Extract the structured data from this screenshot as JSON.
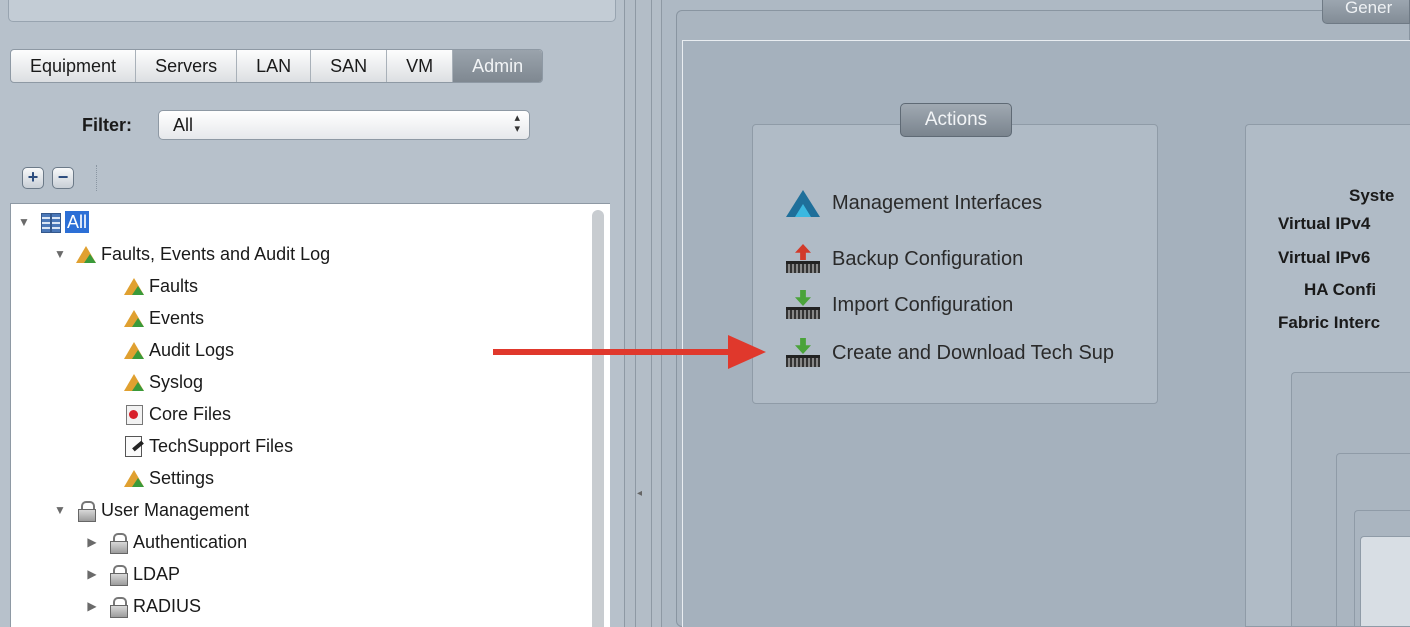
{
  "nav": {
    "tabs": [
      {
        "label": "Equipment"
      },
      {
        "label": "Servers"
      },
      {
        "label": "LAN"
      },
      {
        "label": "SAN"
      },
      {
        "label": "VM"
      },
      {
        "label": "Admin"
      }
    ],
    "active_tab": "Admin",
    "filter": {
      "label": "Filter:",
      "value": "All"
    },
    "tree": {
      "root": "All",
      "faults_group": "Faults, Events and Audit Log",
      "faults_children": [
        "Faults",
        "Events",
        "Audit Logs",
        "Syslog",
        "Core Files",
        "TechSupport Files",
        "Settings"
      ],
      "user_mgmt": "User Management",
      "user_mgmt_children": [
        "Authentication",
        "LDAP",
        "RADIUS"
      ]
    }
  },
  "content": {
    "general_tab": "Gener",
    "actions": {
      "title": "Actions",
      "items": [
        {
          "label": "Management Interfaces",
          "icon": "management-interfaces-icon"
        },
        {
          "label": "Backup Configuration",
          "icon": "backup-icon"
        },
        {
          "label": "Import Configuration",
          "icon": "import-icon"
        },
        {
          "label": "Create and Download Tech Sup",
          "icon": "tech-support-icon"
        }
      ]
    },
    "status_labels": [
      "Syste",
      "Virtual IPv4",
      "Virtual IPv6",
      "HA Confi",
      "Fabric Interc"
    ]
  },
  "colors": {
    "annotation_arrow": "#e0382c",
    "selection": "#2c6fd6"
  }
}
